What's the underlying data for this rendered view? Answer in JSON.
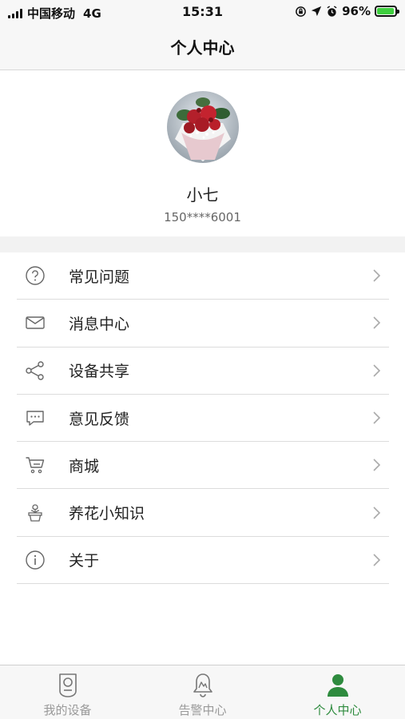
{
  "status_bar": {
    "carrier": "中国移动",
    "network": "4G",
    "time": "15:31",
    "battery_percent": "96%",
    "battery_level": 0.96,
    "battery_color": "#3fcf3f"
  },
  "nav": {
    "title": "个人中心"
  },
  "profile": {
    "username": "小七",
    "phone": "150****6001"
  },
  "menu": {
    "items": [
      {
        "label": "常见问题",
        "icon": "help-icon"
      },
      {
        "label": "消息中心",
        "icon": "mail-icon"
      },
      {
        "label": "设备共享",
        "icon": "share-icon"
      },
      {
        "label": "意见反馈",
        "icon": "feedback-icon"
      },
      {
        "label": "商城",
        "icon": "cart-icon"
      },
      {
        "label": "养花小知识",
        "icon": "flowerpot-icon"
      },
      {
        "label": "关于",
        "icon": "info-icon"
      }
    ]
  },
  "tabs": {
    "items": [
      {
        "label": "我的设备",
        "icon": "device-icon",
        "active": false
      },
      {
        "label": "告警中心",
        "icon": "bell-icon",
        "active": false
      },
      {
        "label": "个人中心",
        "icon": "person-icon",
        "active": true
      }
    ],
    "active_color": "#2e8b3e",
    "inactive_color": "#999999"
  }
}
